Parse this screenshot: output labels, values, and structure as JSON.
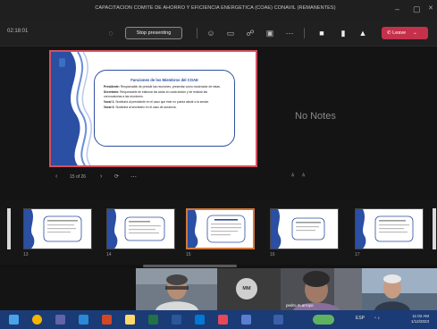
{
  "window": {
    "title": "CAPACITACIÓN COMITÉ DE AHORRO Y EFICIENCIA ENERGÉTICA (COAE) CONAVIL (REMANENTES)",
    "minimize_glyph": "–",
    "close_glyph": "✕"
  },
  "toolbar": {
    "timer": "02:18:01",
    "stop_presenting_label": "Stop presenting",
    "leave_label": "Leave",
    "icons": [
      "cast-icon",
      "reactions-icon",
      "chat-icon",
      "people-icon",
      "rooms-icon",
      "more-icon",
      "camera-icon",
      "mic-icon",
      "share-icon"
    ]
  },
  "presenter": {
    "notes_placeholder": "No Notes",
    "slide_counter": "15 of 26",
    "prev_glyph": "‹",
    "next_glyph": "›"
  },
  "slide": {
    "title": "Funciones de los Miembros del COAE",
    "items": [
      {
        "label": "Presidente:",
        "text": "Responsable de presidir las reuniones, presentar como moderador de estas."
      },
      {
        "label": "Secretario:",
        "text": "Responsable de elaborar las actas en cada sesión y de realizar las convocatorias a las reuniones."
      },
      {
        "label": "Vocal 1:",
        "text": "Sustituirá al presidente en el caso que éste no pueda asistir a la sesión."
      },
      {
        "label": "Vocal 2:",
        "text": "Sustituirá al secretario en el caso de ausencia."
      }
    ]
  },
  "thumbnails": {
    "active_index": 2,
    "numbers": [
      "13",
      "14",
      "15",
      "16",
      "17"
    ]
  },
  "participants": {
    "initials": "MM",
    "tile_name": "pedro.m.arroyo"
  },
  "taskbar": {
    "tray_text": "ESP",
    "time": "11:02 AM",
    "date": "1/12/2023"
  },
  "colors": {
    "leave": "#c4314b",
    "active_thumb": "#d3783a",
    "slide_border": "#d45060",
    "taskbar": "#1a3b75"
  }
}
